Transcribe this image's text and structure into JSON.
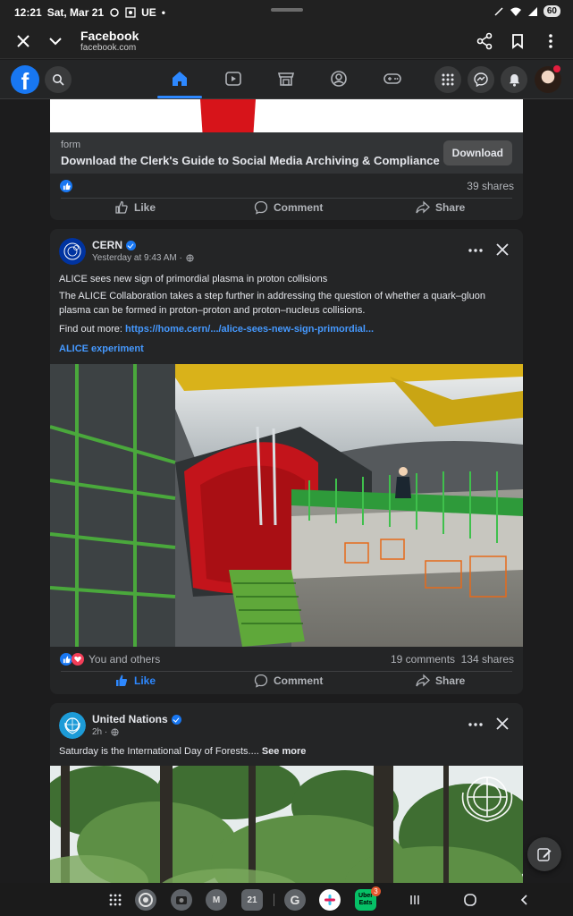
{
  "status_bar": {
    "time": "12:21",
    "date": "Sat, Mar 21",
    "carrier": "UE",
    "battery": "60"
  },
  "browser": {
    "title": "Facebook",
    "url": "facebook.com"
  },
  "colors": {
    "fb_blue": "#1877f2",
    "bg": "#1c1c1d",
    "card": "#242526",
    "link": "#4599ff"
  },
  "ad_post": {
    "label": "form",
    "headline": "Download the Clerk's Guide to Social Media Archiving & Compliance",
    "button": "Download",
    "shares": "39 shares",
    "actions": {
      "like": "Like",
      "comment": "Comment",
      "share": "Share"
    }
  },
  "cern_post": {
    "author": "CERN",
    "time": "Yesterday at 9:43 AM ·",
    "title": "ALICE sees new sign of primordial plasma in proton collisions",
    "body": "The ALICE Collaboration takes a step further in addressing the question of whether a quark–gluon plasma can be formed in proton–proton and proton–nucleus collisions.",
    "find_prefix": "Find out more: ",
    "find_link": "https://home.cern/.../alice-sees-new-sign-primordial...",
    "hashtag": "ALICE experiment",
    "reactions": "You and others",
    "comments": "19 comments",
    "shares": "134 shares",
    "actions": {
      "like": "Like",
      "comment": "Comment",
      "share": "Share"
    }
  },
  "un_post": {
    "author": "United Nations",
    "time": "2h ·",
    "text": "Saturday is the International Day of Forests.... ",
    "see_more": "See more"
  },
  "taskbar": {
    "calendar_day": "21",
    "uber_label": "Uber Eats",
    "uber_badge": "3"
  }
}
